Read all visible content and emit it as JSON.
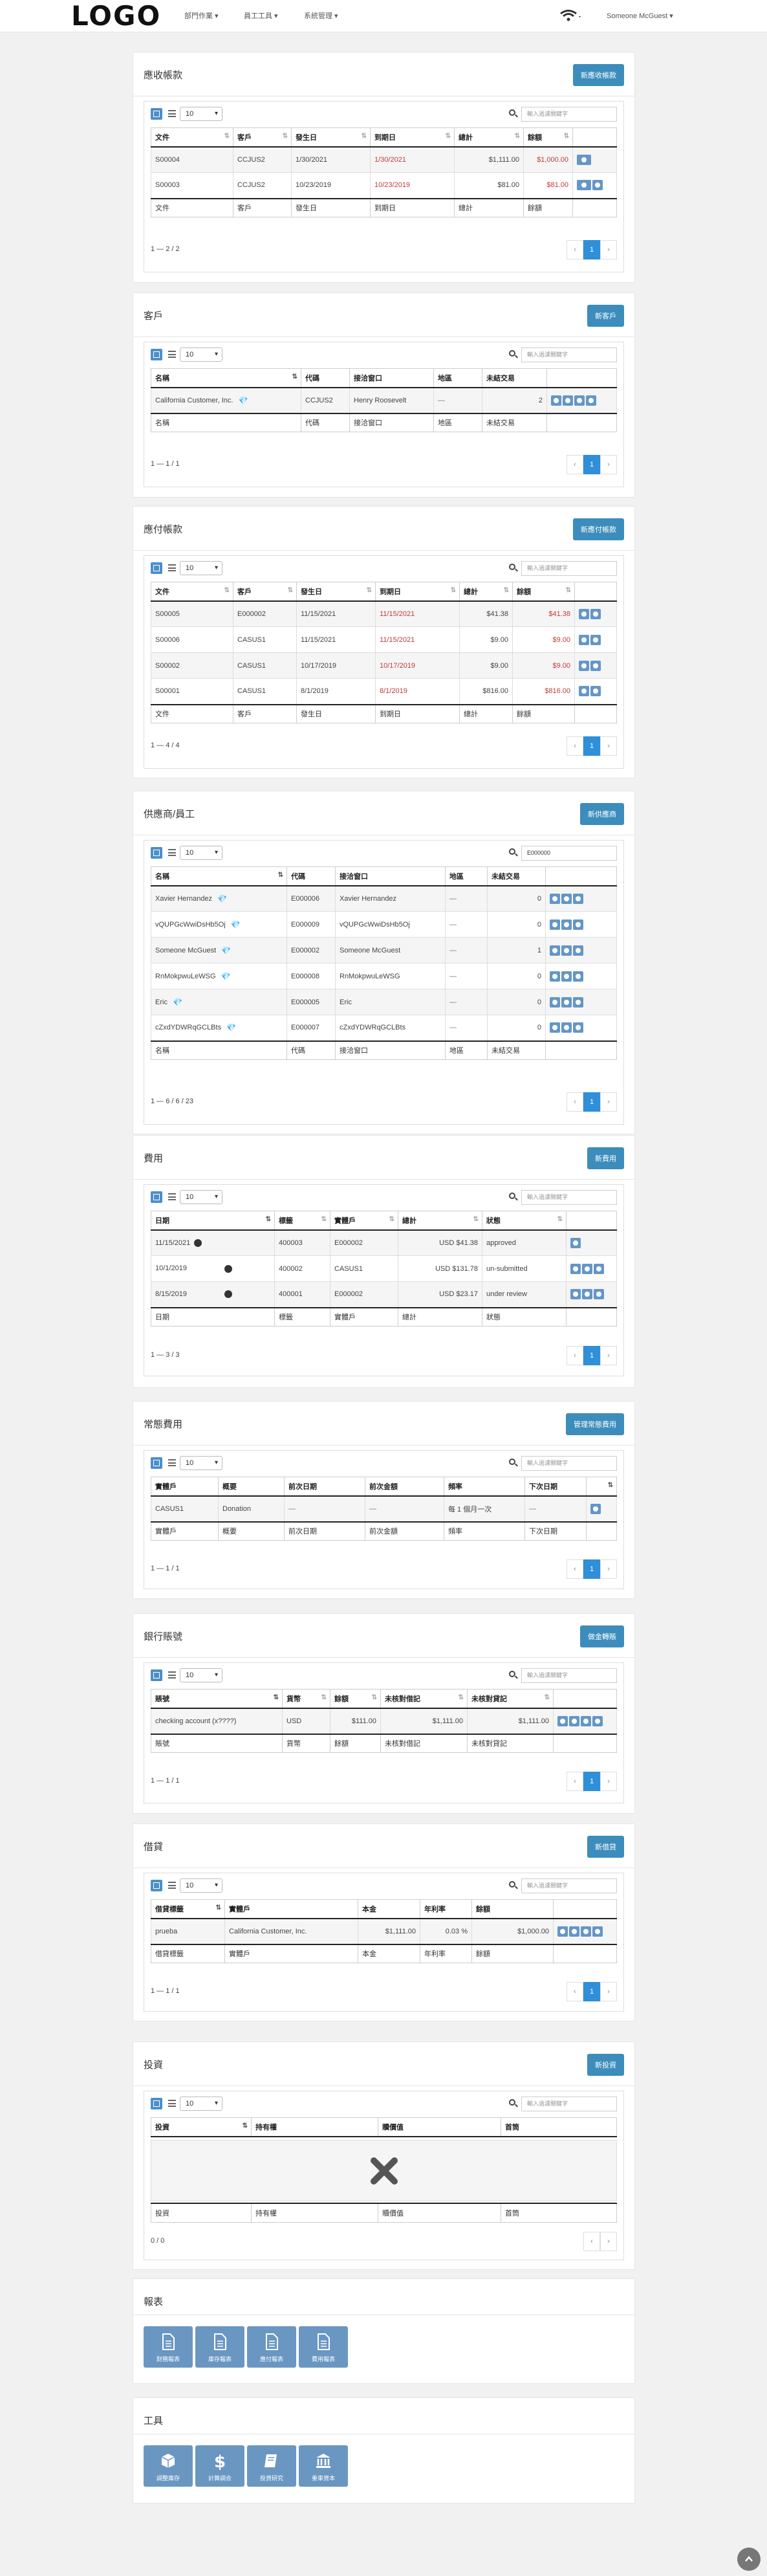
{
  "nav": {
    "logo": "LOGO",
    "menu1": "部門作業 ▾",
    "menu2": "員工工具 ▾",
    "menu3": "系統管理 ▾",
    "user": "Someone McGuest ▾"
  },
  "ar": {
    "title": "應收帳款",
    "button": "新應收帳款",
    "page_len": "10",
    "search_placeholder": "輸入過濾關鍵字",
    "headers": [
      "文件",
      "客戶",
      "發生日",
      "到期日",
      "總計",
      "餘額",
      ""
    ],
    "rows": [
      {
        "doc": "S00004",
        "cust": "CCJUS2",
        "issued": "1/30/2021",
        "due": "1/30/2021",
        "total": "$1,111.00",
        "bal": "$1,000.00"
      },
      {
        "doc": "S00003",
        "cust": "CCJUS2",
        "issued": "10/23/2019",
        "due": "10/23/2019",
        "total": "$81.00",
        "bal": "$81.00"
      }
    ],
    "info": "1 — 2 / 2",
    "page": "1"
  },
  "cust": {
    "title": "客戶",
    "button": "新客戶",
    "page_len": "10",
    "search_placeholder": "輸入過濾關鍵字",
    "headers": [
      "名稱",
      "代碼",
      "接洽窗口",
      "地區",
      "未結交易",
      ""
    ],
    "rows": [
      {
        "name": "California Customer, Inc.",
        "code": "CCJUS2",
        "contact": "Henry Roosevelt",
        "region": "—",
        "open": "2"
      }
    ],
    "info": "1 — 1 / 1",
    "page": "1"
  },
  "ap": {
    "title": "應付帳款",
    "button": "新應付帳款",
    "page_len": "10",
    "search_placeholder": "輸入過濾關鍵字",
    "headers": [
      "文件",
      "客戶",
      "發生日",
      "到期日",
      "總計",
      "餘額",
      ""
    ],
    "rows": [
      {
        "doc": "S00005",
        "cust": "E000002",
        "issued": "11/15/2021",
        "due": "11/15/2021",
        "total": "$41.38",
        "bal": "$41.38"
      },
      {
        "doc": "S00006",
        "cust": "CASUS1",
        "issued": "11/15/2021",
        "due": "11/15/2021",
        "total": "$9.00",
        "bal": "$9.00"
      },
      {
        "doc": "S00002",
        "cust": "CASUS1",
        "issued": "10/17/2019",
        "due": "10/17/2019",
        "total": "$9.00",
        "bal": "$9.00"
      },
      {
        "doc": "S00001",
        "cust": "CASUS1",
        "issued": "8/1/2019",
        "due": "8/1/2019",
        "total": "$816.00",
        "bal": "$816.00"
      }
    ],
    "info": "1 — 4 / 4",
    "page": "1"
  },
  "vendor": {
    "title": "供應商/員工",
    "button": "新供應商",
    "page_len": "10",
    "search_value": "E000000",
    "headers": [
      "名稱",
      "代碼",
      "接洽窗口",
      "地區",
      "未結交易",
      ""
    ],
    "rows": [
      {
        "name": "Xavier Hernandez",
        "code": "E000006",
        "contact": "Xavier Hernandez",
        "region": "—",
        "open": "0"
      },
      {
        "name": "vQUPGcWwiDsHb5Oj",
        "code": "E000009",
        "contact": "vQUPGcWwiDsHb5Oj",
        "region": "—",
        "open": "0"
      },
      {
        "name": "Someone McGuest",
        "code": "E000002",
        "contact": "Someone McGuest",
        "region": "—",
        "open": "1"
      },
      {
        "name": "RnMokpwuLeWSG",
        "code": "E000008",
        "contact": "RnMokpwuLeWSG",
        "region": "—",
        "open": "0"
      },
      {
        "name": "Eric",
        "code": "E000005",
        "contact": "Eric",
        "region": "—",
        "open": "0"
      },
      {
        "name": "cZxdYDWRqGCLBts",
        "code": "E000007",
        "contact": "cZxdYDWRqGCLBts",
        "region": "—",
        "open": "0"
      }
    ],
    "info": "1 — 6 / 6 / 23",
    "page": "1"
  },
  "exp": {
    "title": "費用",
    "button": "新費用",
    "page_len": "10",
    "search_placeholder": "輸入過濾關鍵字",
    "headers": [
      "日期",
      "標籤",
      "實體戶",
      "總計",
      "狀態",
      ""
    ],
    "rows": [
      {
        "date": "11/15/2021",
        "tag": "400003",
        "entity": "E000002",
        "total": "USD $41.38",
        "status": "approved"
      },
      {
        "date": "10/1/2019",
        "tag": "400002",
        "entity": "CASUS1",
        "total": "USD $131.78",
        "status": "un-submitted"
      },
      {
        "date": "8/15/2019",
        "tag": "400001",
        "entity": "E000002",
        "total": "USD $23.17",
        "status": "under review"
      }
    ],
    "info": "1 — 3 / 3",
    "page": "1"
  },
  "recur": {
    "title": "常態費用",
    "button": "管理常態費用",
    "page_len": "10",
    "search_placeholder": "輸入過濾關鍵字",
    "headers": [
      "實體戶",
      "概要",
      "前次日期",
      "前次金額",
      "頻率",
      "下次日期",
      ""
    ],
    "rows": [
      {
        "entity": "CASUS1",
        "summary": "Donation",
        "last_date": "—",
        "last_amt": "—",
        "freq": "每 1 個月一次",
        "next": "—"
      }
    ],
    "info": "1 — 1 / 1",
    "page": "1"
  },
  "bank": {
    "title": "銀行賬號",
    "button": "做金轉賬",
    "page_len": "10",
    "search_placeholder": "輸入過濾關鍵字",
    "headers": [
      "賬號",
      "貨幣",
      "餘額",
      "未核對借記",
      "未核對貸記",
      ""
    ],
    "rows": [
      {
        "account": "checking account (x????)",
        "currency": "USD",
        "balance": "$111.00",
        "debit": "$1,111.00",
        "credit": "$1,111.00"
      }
    ],
    "info": "1 — 1 / 1",
    "page": "1"
  },
  "loan": {
    "title": "借貸",
    "button": "新借貸",
    "page_len": "10",
    "search_placeholder": "輸入過濾關鍵字",
    "headers": [
      "借貸標籤",
      "實體戶",
      "本金",
      "年利率",
      "餘額",
      ""
    ],
    "rows": [
      {
        "tag": "prueba",
        "entity": "California Customer, Inc.",
        "principal": "$1,111.00",
        "rate": "0.03 %",
        "balance": "$1,000.00"
      }
    ],
    "info": "1 — 1 / 1",
    "page": "1"
  },
  "inv": {
    "title": "投資",
    "button": "新投資",
    "page_len": "10",
    "search_placeholder": "輸入過濾關鍵字",
    "headers": [
      "投資",
      "持有權",
      "贖價值",
      "首筒"
    ],
    "info": "0 / 0"
  },
  "reports": {
    "title": "報表",
    "tiles": [
      "財務報表",
      "庫存報表",
      "應付報表",
      "費用報表"
    ]
  },
  "tools": {
    "title": "工具",
    "tiles": [
      "調整庫存",
      "計算調合",
      "投資研究",
      "重車資本"
    ]
  }
}
